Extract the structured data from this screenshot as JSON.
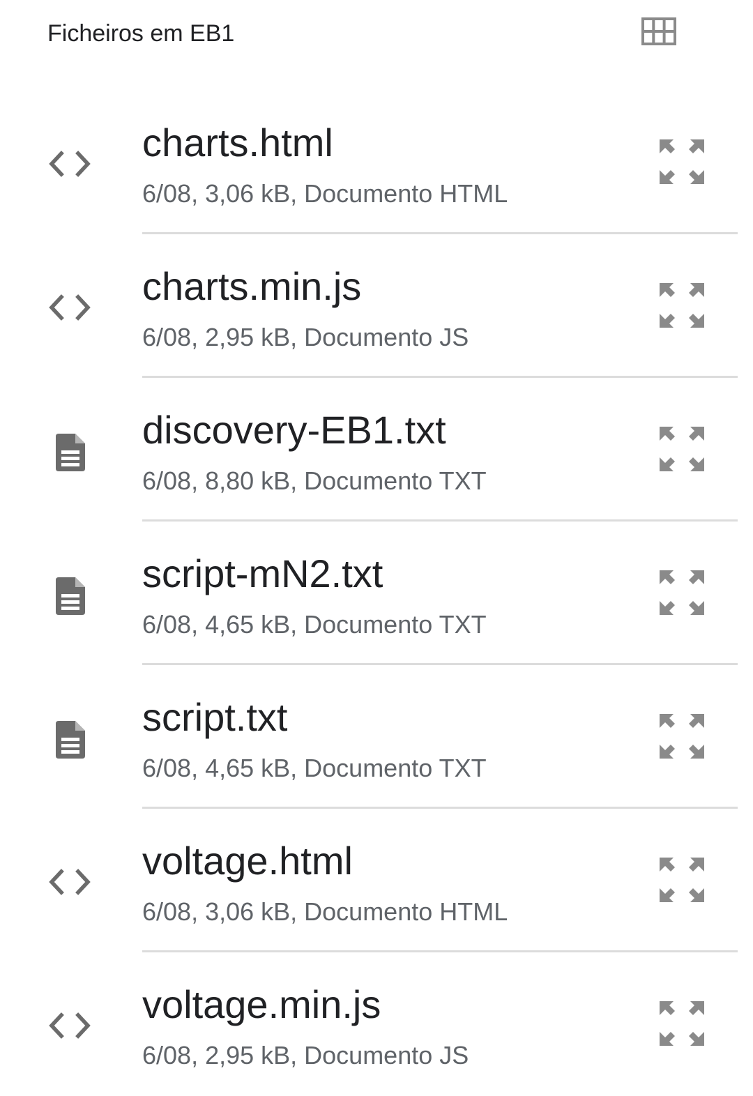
{
  "header": {
    "title": "Ficheiros em EB1",
    "view_toggle_icon": "grid-view-icon"
  },
  "files": [
    {
      "name": "charts.html",
      "meta": "6/08, 3,06 kB, Documento HTML",
      "icon": "code-icon"
    },
    {
      "name": "charts.min.js",
      "meta": "6/08, 2,95 kB, Documento JS",
      "icon": "code-icon"
    },
    {
      "name": "discovery-EB1.txt",
      "meta": "6/08, 8,80 kB, Documento TXT",
      "icon": "document-icon"
    },
    {
      "name": "script-mN2.txt",
      "meta": "6/08, 4,65 kB, Documento TXT",
      "icon": "document-icon"
    },
    {
      "name": "script.txt",
      "meta": "6/08, 4,65 kB, Documento TXT",
      "icon": "document-icon"
    },
    {
      "name": "voltage.html",
      "meta": "6/08, 3,06 kB, Documento HTML",
      "icon": "code-icon"
    },
    {
      "name": "voltage.min.js",
      "meta": "6/08, 2,95 kB, Documento JS",
      "icon": "code-icon"
    }
  ],
  "colors": {
    "icon": "#6b6b6b",
    "text_primary": "#202124",
    "text_secondary": "#5f6368",
    "divider": "#dcdcdc"
  }
}
